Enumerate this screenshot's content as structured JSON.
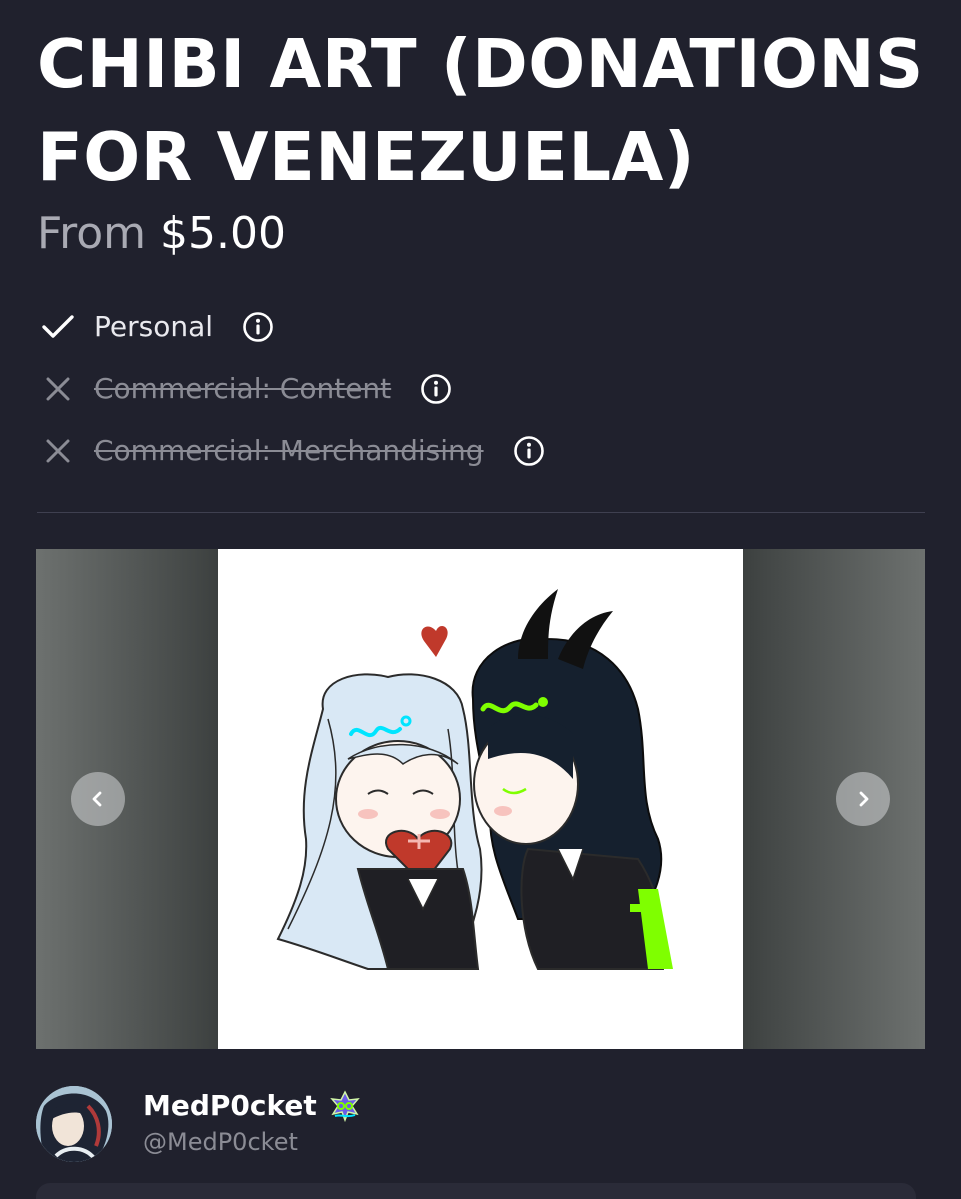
{
  "listing": {
    "title": "CHIBI ART (DONATIONS FOR VENEZUELA)",
    "price_prefix": "From",
    "price": "$5.00"
  },
  "licenses": [
    {
      "label": "Personal",
      "included": true,
      "status_icon": "check-icon"
    },
    {
      "label": "Commercial: Content",
      "included": false,
      "status_icon": "x-icon"
    },
    {
      "label": "Commercial: Merchandising",
      "included": false,
      "status_icon": "x-icon"
    }
  ],
  "gallery": {
    "image_description": "chibi-art-sample",
    "prev_icon": "chevron-left-icon",
    "next_icon": "chevron-right-icon"
  },
  "creator": {
    "name": "MedP0cket",
    "handle": "@MedP0cket",
    "badge_icon": "sparkle-badge-icon"
  },
  "colors": {
    "background": "#20212d",
    "muted_text": "#8b8c95",
    "accent_green": "#7fff00",
    "accent_cyan": "#00e5ff"
  }
}
